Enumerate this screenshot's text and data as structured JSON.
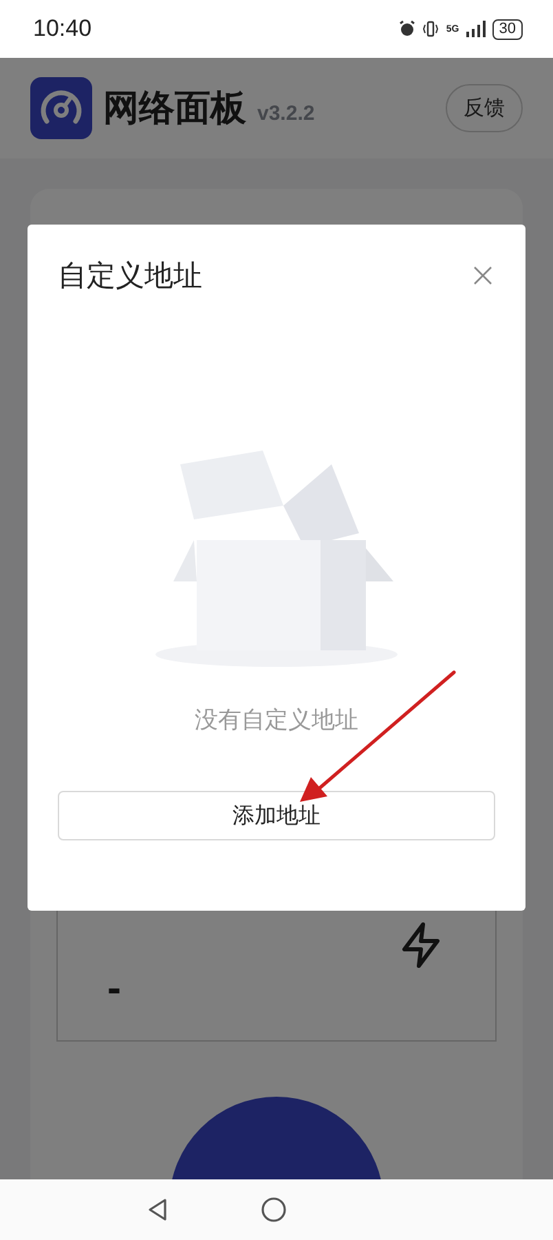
{
  "status_bar": {
    "time": "10:40",
    "network": "5G",
    "battery": "30"
  },
  "header": {
    "title": "网络面板",
    "version": "v3.2.2",
    "feedback_button": "反馈"
  },
  "result_card": {
    "value": "-"
  },
  "dialog": {
    "title": "自定义地址",
    "empty_text": "没有自定义地址",
    "add_button": "添加地址"
  }
}
